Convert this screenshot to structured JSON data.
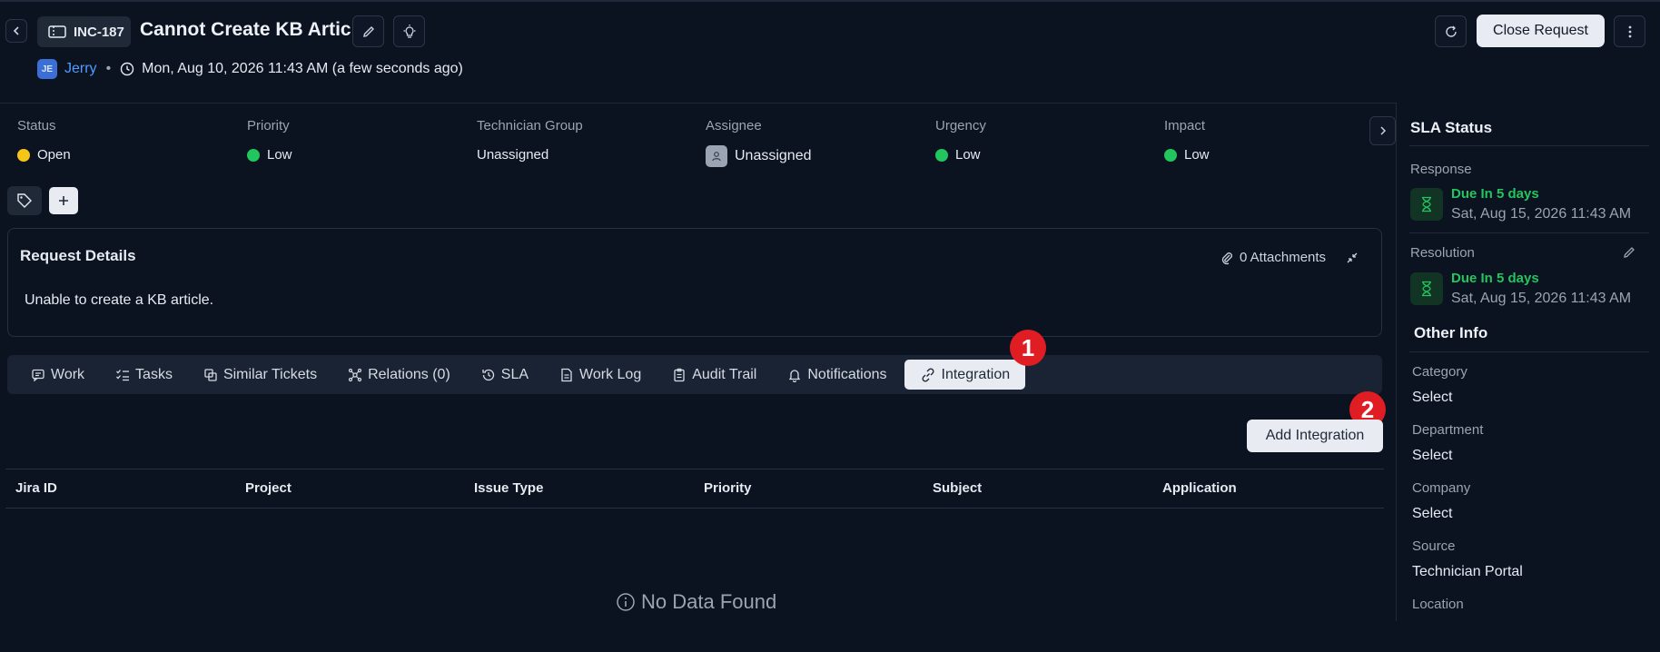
{
  "header": {
    "ticket_id": "INC-187",
    "title": "Cannot Create KB Article",
    "requester_initials": "JE",
    "requester_name": "Jerry",
    "separator": "•",
    "timestamp": "Mon, Aug 10, 2026 11:43 AM (a few seconds ago)",
    "close_button": "Close Request"
  },
  "fields": [
    {
      "label": "Status",
      "value": "Open",
      "color": "#f5c518"
    },
    {
      "label": "Priority",
      "value": "Low",
      "color": "#22c55e"
    },
    {
      "label": "Technician Group",
      "value": "Unassigned"
    },
    {
      "label": "Assignee",
      "value": "Unassigned"
    },
    {
      "label": "Urgency",
      "value": "Low",
      "color": "#22c55e"
    },
    {
      "label": "Impact",
      "value": "Low",
      "color": "#22c55e"
    }
  ],
  "request_details": {
    "title": "Request Details",
    "attachments": "0 Attachments",
    "body": "Unable to create a KB article."
  },
  "tabs": [
    {
      "label": "Work",
      "icon": "chat-icon"
    },
    {
      "label": "Tasks",
      "icon": "checklist-icon"
    },
    {
      "label": "Similar Tickets",
      "icon": "copy-icon"
    },
    {
      "label": "Relations (0)",
      "icon": "relations-icon"
    },
    {
      "label": "SLA",
      "icon": "history-icon"
    },
    {
      "label": "Work Log",
      "icon": "document-icon"
    },
    {
      "label": "Audit Trail",
      "icon": "clipboard-icon"
    },
    {
      "label": "Notifications",
      "icon": "bell-icon"
    },
    {
      "label": "Integration",
      "icon": "link-icon",
      "active": true
    }
  ],
  "annotations": [
    "1",
    "2"
  ],
  "integration": {
    "add_button": "Add Integration",
    "columns": [
      "Jira ID",
      "Project",
      "Issue Type",
      "Priority",
      "Subject",
      "Application"
    ],
    "empty": "No Data Found"
  },
  "sla": {
    "title": "SLA Status",
    "response": {
      "label": "Response",
      "due": "Due In 5 days",
      "date": "Sat, Aug 15, 2026 11:43 AM"
    },
    "resolution": {
      "label": "Resolution",
      "due": "Due In 5 days",
      "date": "Sat, Aug 15, 2026 11:43 AM"
    }
  },
  "other_info": {
    "title": "Other Info",
    "items": [
      {
        "label": "Category",
        "value": "Select"
      },
      {
        "label": "Department",
        "value": "Select"
      },
      {
        "label": "Company",
        "value": "Select"
      },
      {
        "label": "Source",
        "value": "Technician Portal"
      },
      {
        "label": "Location",
        "value": ""
      }
    ]
  }
}
